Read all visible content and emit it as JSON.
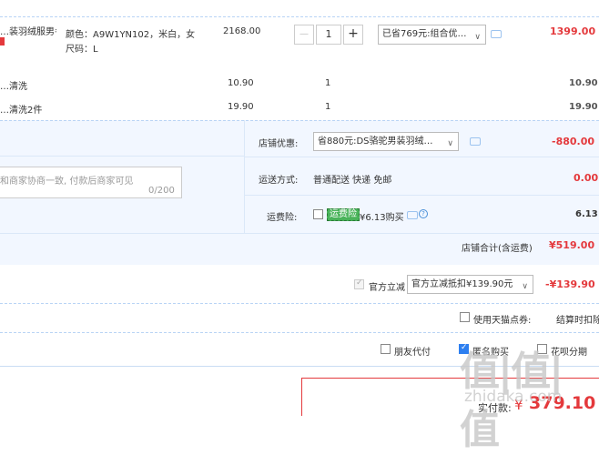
{
  "item": {
    "name": "…装羽绒服男冬…",
    "color_label": "颜色：A9W1YN102，米白，女",
    "size_label": "尺码：L",
    "unit_price": "2168.00",
    "qty": "1",
    "minus": "—",
    "plus": "+",
    "discount_select": "已省769元:组合优…",
    "total": "1399.00"
  },
  "services": [
    {
      "name": "…清洗",
      "price": "10.90",
      "qty": "1",
      "total": "10.90"
    },
    {
      "name": "…清洗2件",
      "price": "19.90",
      "qty": "1",
      "total": "19.90"
    }
  ],
  "store": {
    "discount_label": "店铺优惠:",
    "discount_select": "省880元:DS骆驼男装羽绒…",
    "discount_value": "-880.00",
    "shipping_label": "运送方式:",
    "shipping_value": "普通配送 快递 免邮",
    "shipping_fee": "0.00",
    "insurance_label": "运费险:",
    "insurance_badge": "运费险",
    "insurance_text": "¥6.13购买",
    "insurance_value": "6.13",
    "subtotal_label": "店铺合计(含运费)",
    "subtotal_value": "¥519.00"
  },
  "message": {
    "placeholder": "和商家协商一致, 付款后商家可见",
    "counter": "0/200"
  },
  "official": {
    "label": "官方立减",
    "select": "官方立减抵扣¥139.90元",
    "value": "-¥139.90"
  },
  "coupon": {
    "label": "使用天猫点券:",
    "note": "结算时扣除"
  },
  "options": {
    "friend_pay": "朋友代付",
    "anonymous": "匿名购买",
    "private": "花呗分期"
  },
  "payment": {
    "label": "实付款:",
    "currency": "¥",
    "amount": "379.10"
  },
  "watermark": {
    "text": "值|值|值",
    "site": "zhidaka.com"
  }
}
